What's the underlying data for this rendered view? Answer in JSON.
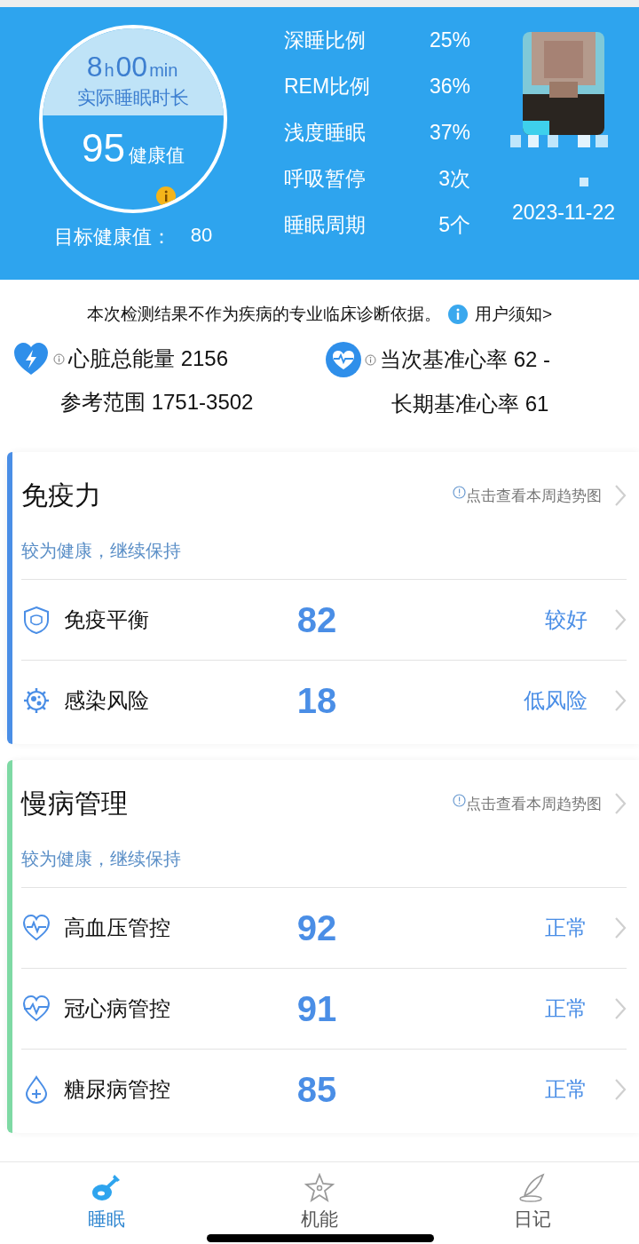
{
  "header": {
    "duration": [
      {
        "text": "8",
        "kind": "number"
      },
      {
        "text": "h",
        "kind": "unit"
      },
      {
        "text": "00",
        "kind": "number"
      },
      {
        "text": "min",
        "kind": "unit"
      }
    ],
    "duration_label": "实际睡眠时长",
    "score": "95",
    "score_label": "健康值",
    "target_label": "目标健康值：",
    "target": "80",
    "stats": [
      {
        "label": "深睡比例",
        "value": "25%"
      },
      {
        "label": "REM比例",
        "value": "36%"
      },
      {
        "label": "浅度睡眠",
        "value": "37%"
      },
      {
        "label": "呼吸暂停",
        "value": "3次"
      },
      {
        "label": "睡眠周期",
        "value": "5个"
      }
    ],
    "date": "2023-11-22"
  },
  "notice": {
    "text": "本次检测结果不作为疾病的专业临床诊断依据。",
    "link": "用户须知>"
  },
  "heart_metrics": [
    {
      "kind": "energy",
      "line1": "心脏总能量 2156",
      "line2": "参考范围 1751-3502"
    },
    {
      "kind": "rate",
      "line1": "当次基准心率 62  -",
      "line2": "长期基准心率 61"
    }
  ],
  "cards": [
    {
      "title": "免疫力",
      "color": "#4a8ee6",
      "trend_link": "点击查看本周趋势图",
      "summary": "较为健康，继续保持",
      "items": [
        {
          "kind": "shield",
          "name": "免疫平衡",
          "score": "82",
          "status": "较好"
        },
        {
          "kind": "virus",
          "name": "感染风险",
          "score": "18",
          "status": "低风险"
        }
      ]
    },
    {
      "title": "慢病管理",
      "color": "#7ed9a4",
      "trend_link": "点击查看本周趋势图",
      "summary": "较为健康，继续保持",
      "items": [
        {
          "kind": "heart",
          "name": "高血压管控",
          "score": "92",
          "status": "正常"
        },
        {
          "kind": "heart-pulse",
          "name": "冠心病管控",
          "score": "91",
          "status": "正常"
        },
        {
          "kind": "drop",
          "name": "糖尿病管控",
          "score": "85",
          "status": "正常"
        }
      ]
    }
  ],
  "tabs": [
    {
      "kind": "sleep",
      "label": "睡眠",
      "selected": true
    },
    {
      "kind": "function",
      "label": "机能",
      "selected": false
    },
    {
      "kind": "diary",
      "label": "日记",
      "selected": false
    }
  ]
}
